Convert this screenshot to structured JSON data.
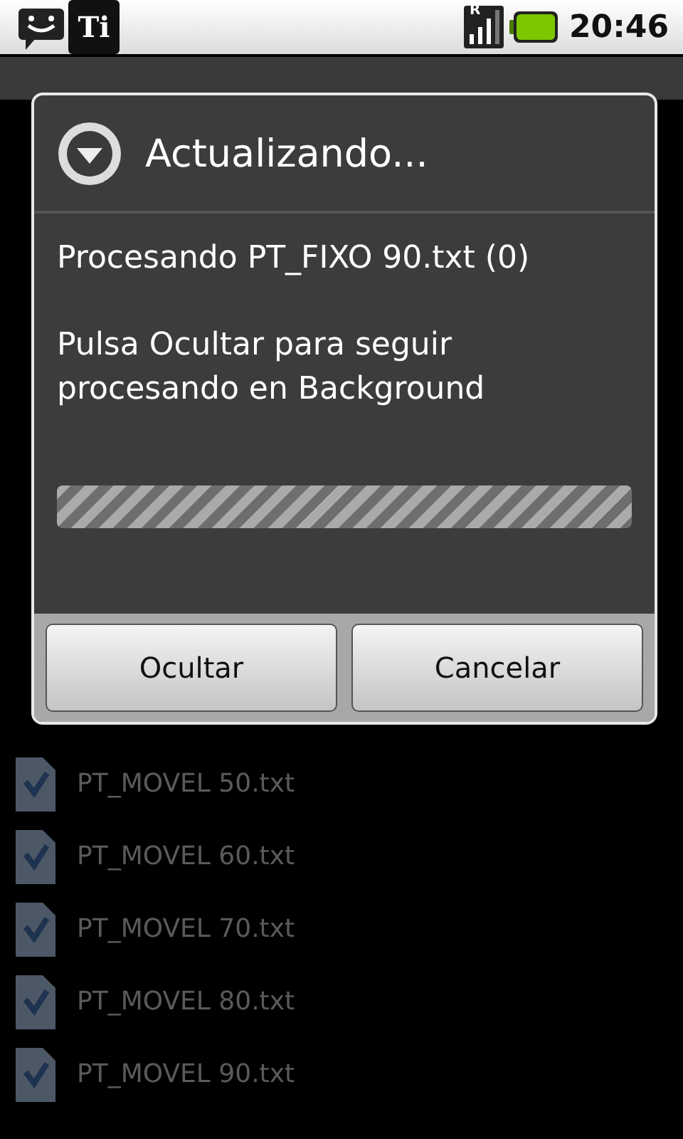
{
  "status_bar": {
    "time": "20:46",
    "roaming_mark": "R"
  },
  "notification_icons": [
    {
      "kind": "chat"
    },
    {
      "kind": "app",
      "label": "Ti"
    }
  ],
  "file_list": [
    {
      "name": "PT_MOVEL 50.txt"
    },
    {
      "name": "PT_MOVEL 60.txt"
    },
    {
      "name": "PT_MOVEL 70.txt"
    },
    {
      "name": "PT_MOVEL 80.txt"
    },
    {
      "name": "PT_MOVEL 90.txt"
    }
  ],
  "dialog": {
    "title": "Actualizando...",
    "message": "Procesando PT_FIXO 90.txt (0)",
    "hint": "Pulsa Ocultar para seguir procesando en Background",
    "progress": {
      "indeterminate": true
    },
    "buttons": [
      "Ocultar",
      "Cancelar"
    ]
  }
}
